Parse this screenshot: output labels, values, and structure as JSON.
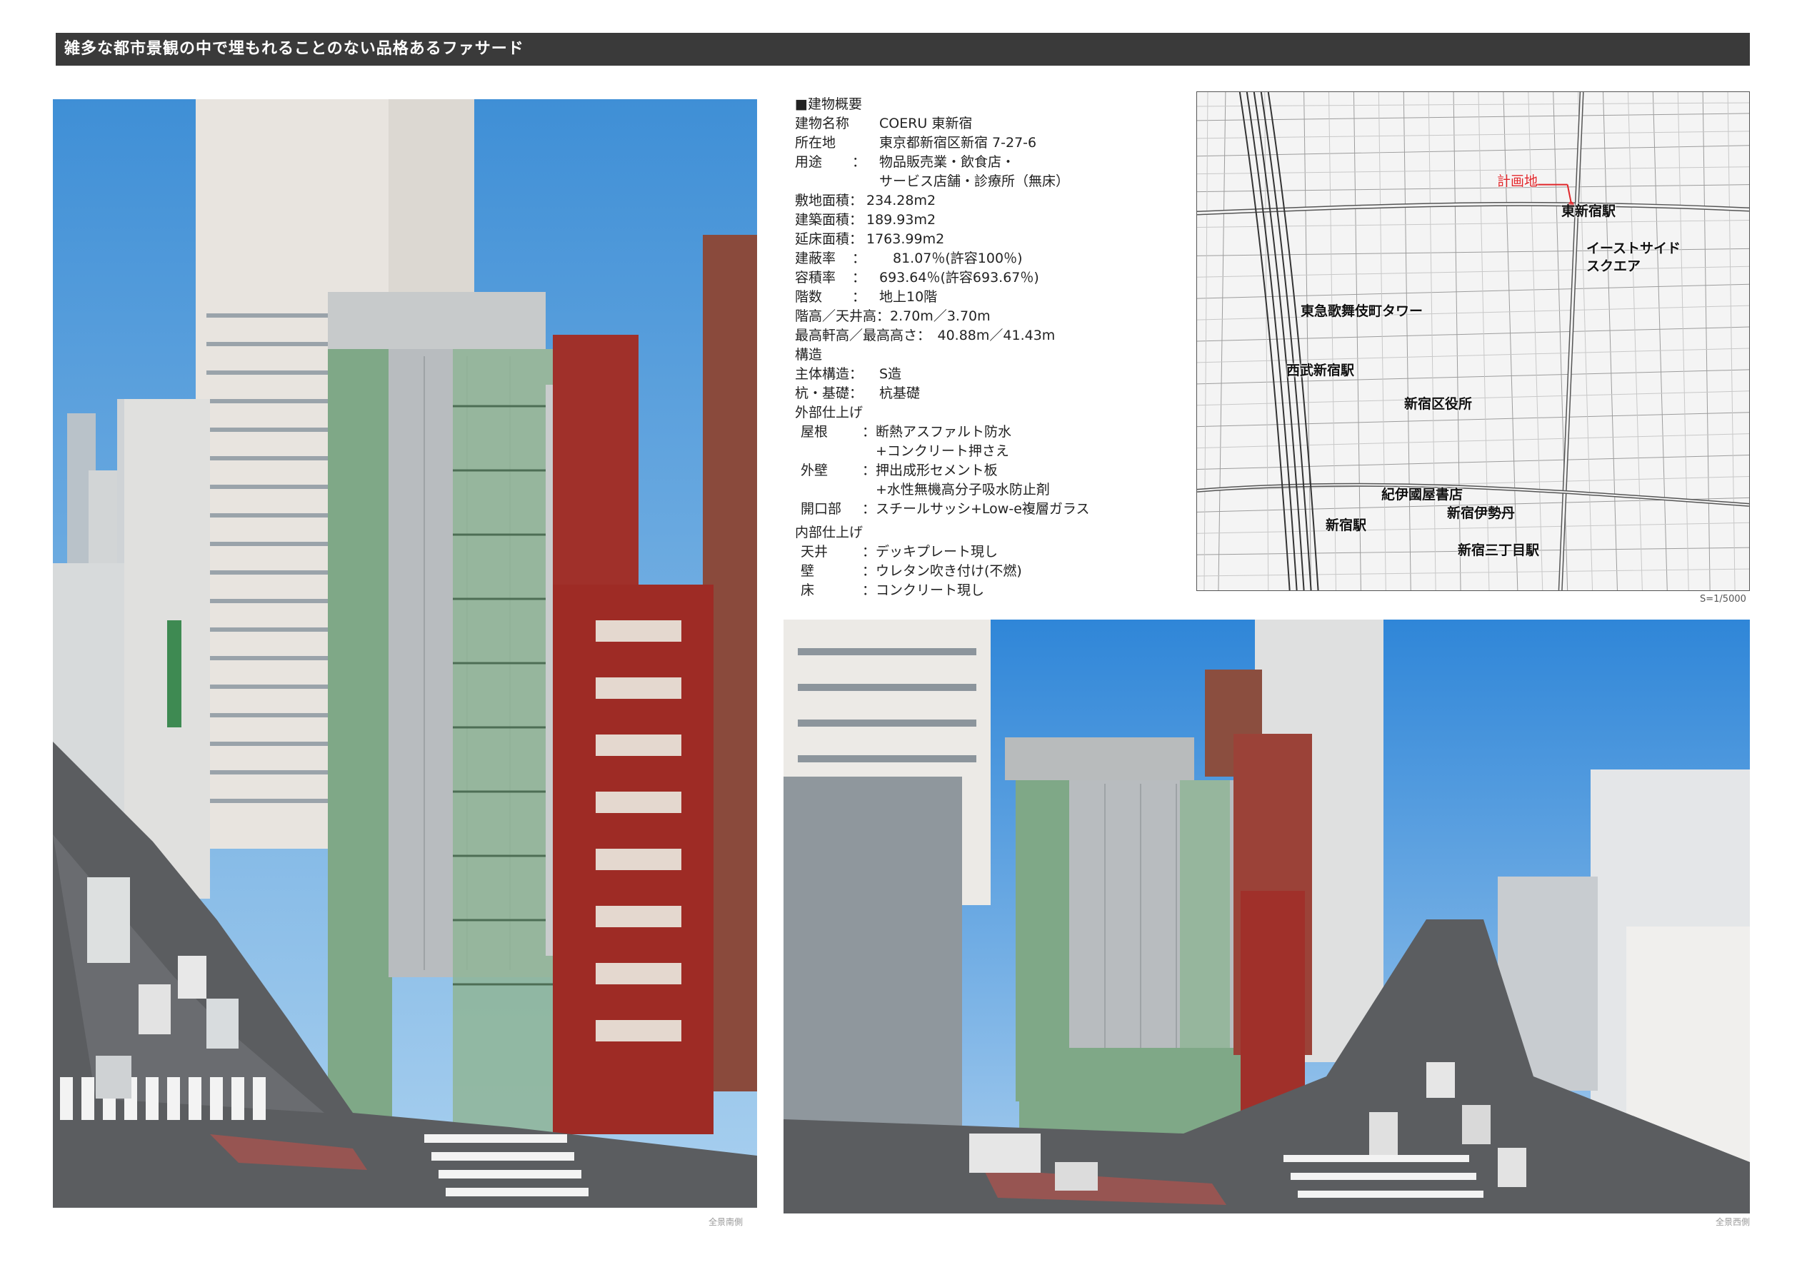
{
  "title": "雑多な都市景観の中で埋もれることのない品格あるファサード",
  "overview": {
    "heading": "■建物概要",
    "rows": [
      {
        "label": "建物名称",
        "sep": "",
        "value": "COERU 東新宿"
      },
      {
        "label": "所在地",
        "sep": "",
        "value": "東京都新宿区新宿 7-27-6"
      },
      {
        "label": "用途",
        "sep": "：",
        "value": "物品販売業・飲食店・"
      },
      {
        "label": "",
        "sep": "",
        "value": "サービス店舗・診療所（無床）"
      },
      {
        "label": "敷地面積：",
        "sep": "",
        "value": "234.28m2"
      },
      {
        "label": "建築面積：",
        "sep": "",
        "value": "189.93m2"
      },
      {
        "label": "延床面積：",
        "sep": "",
        "value": "1763.99m2"
      },
      {
        "label": "建蔽率",
        "sep": "：",
        "value": "　81.07％(許容100％)"
      },
      {
        "label": "容積率",
        "sep": "：",
        "value": "693.64％(許容693.67％)"
      },
      {
        "label": "階数",
        "sep": "：",
        "value": "地上10階"
      }
    ],
    "floor_height": "階高／天井高：2.70m／3.70m",
    "max_height": "最高軒高／最高高さ：　40.88m／41.43m",
    "structure_heading": "構造",
    "structure_rows": [
      {
        "label": "主体構造：",
        "value": "S造"
      },
      {
        "label": "杭・基礎：",
        "value": "杭基礎"
      }
    ],
    "exterior_heading": "外部仕上げ",
    "exterior_rows": [
      {
        "label": "屋根",
        "value": "：断熱アスファルト防水"
      },
      {
        "label": "",
        "value": "　+コンクリート押さえ"
      },
      {
        "label": "外壁",
        "value": "：押出成形セメント板"
      },
      {
        "label": "",
        "value": "　+水性無機高分子吸水防止剤"
      },
      {
        "label": "開口部",
        "value": "：スチールサッシ+Low-e複層ガラス"
      }
    ],
    "interior_heading": "内部仕上げ",
    "interior_rows": [
      {
        "label": "天井",
        "value": "：デッキプレート現し"
      },
      {
        "label": "壁",
        "value": "：ウレタン吹き付け(不燃)"
      },
      {
        "label": "床",
        "value": "：コンクリート現し"
      }
    ]
  },
  "map": {
    "labels": {
      "site": "計画地",
      "higashi_shinjuku": "東新宿駅",
      "eastside_1": "イーストサイド",
      "eastside_2": "スクエア",
      "tokyu": "東急歌舞伎町タワー",
      "seibu": "西武新宿駅",
      "ward_office": "新宿区役所",
      "kinokuniya": "紀伊國屋書店",
      "isetan": "新宿伊勢丹",
      "shinjuku": "新宿駅",
      "sanchome": "新宿三丁目駅"
    },
    "scale": "S=1/5000"
  },
  "photos": {
    "south_caption": "全景南側",
    "west_caption": "全景西側"
  },
  "colors": {
    "title_bar": "#3a3a3a",
    "sky": "#5fa2dc",
    "facade_gray": "#b8bcbf",
    "glass_green": "#7fa887",
    "brick_red": "#9e2b25",
    "site_marker": "#e0262a"
  }
}
